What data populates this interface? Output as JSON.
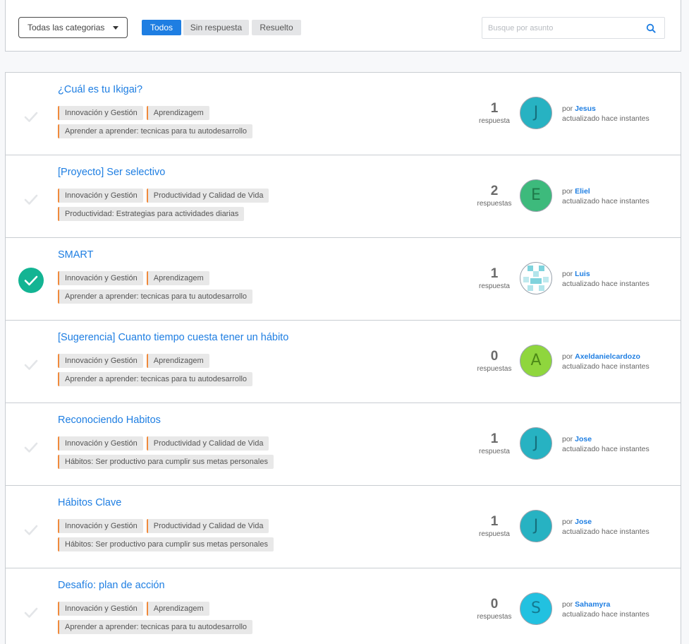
{
  "filters": {
    "category_selected": "Todas las categorias",
    "segments": [
      {
        "label": "Todos",
        "active": true
      },
      {
        "label": "Sin respuesta",
        "active": false
      },
      {
        "label": "Resuelto",
        "active": false
      }
    ],
    "search_placeholder": "Busque por asunto"
  },
  "colors": {
    "accent": "#1e7ee2",
    "tag_border": "#f08a3c",
    "solved": "#13b493"
  },
  "topics": [
    {
      "title": "¿Cuál es tu Ikigai?",
      "solved": false,
      "tags_row1": [
        "Innovación y Gestión",
        "Aprendizagem"
      ],
      "tags_row2": [
        "Aprender a aprender: tecnicas para tu autodesarrollo"
      ],
      "count": "1",
      "count_label": "respuesta",
      "avatar_letter": "J",
      "avatar_bg": "#27b2c2",
      "avatar_fg": "#166f7c",
      "by_prefix": "por",
      "user": "Jesus",
      "updated": "actualizado hace instantes"
    },
    {
      "title": "[Proyecto] Ser selectivo",
      "solved": false,
      "tags_row1": [
        "Innovación y Gestión",
        "Productividad y Calidad de Vida"
      ],
      "tags_row2": [
        "Productividad: Estrategias para actividades diarias"
      ],
      "count": "2",
      "count_label": "respuestas",
      "avatar_letter": "E",
      "avatar_bg": "#3dba7c",
      "avatar_fg": "#1f7a4a",
      "by_prefix": "por",
      "user": "Eliel",
      "updated": "actualizado hace instantes"
    },
    {
      "title": "SMART",
      "solved": true,
      "tags_row1": [
        "Innovación y Gestión",
        "Aprendizagem"
      ],
      "tags_row2": [
        "Aprender a aprender: tecnicas para tu autodesarrollo"
      ],
      "count": "1",
      "count_label": "respuesta",
      "avatar_letter": "",
      "avatar_bg": "#ffffff",
      "avatar_fg": "#7fd3dd",
      "by_prefix": "por",
      "user": "Luis",
      "updated": "actualizado hace instantes"
    },
    {
      "title": "[Sugerencia] Cuanto tiempo cuesta tener un hábito",
      "solved": false,
      "tags_row1": [
        "Innovación y Gestión",
        "Aprendizagem"
      ],
      "tags_row2": [
        "Aprender a aprender: tecnicas para tu autodesarrollo"
      ],
      "count": "0",
      "count_label": "respuestas",
      "avatar_letter": "A",
      "avatar_bg": "#8fd63d",
      "avatar_fg": "#4d8a17",
      "by_prefix": "por",
      "user": "Axeldanielcardozo",
      "updated": "actualizado hace instantes"
    },
    {
      "title": "Reconociendo Habitos",
      "solved": false,
      "tags_row1": [
        "Innovación y Gestión",
        "Productividad y Calidad de Vida"
      ],
      "tags_row2": [
        "Hábitos: Ser productivo para cumplir sus metas personales"
      ],
      "count": "1",
      "count_label": "respuesta",
      "avatar_letter": "J",
      "avatar_bg": "#27b2c2",
      "avatar_fg": "#166f7c",
      "by_prefix": "por",
      "user": "Jose",
      "updated": "actualizado hace instantes"
    },
    {
      "title": "Hábitos Clave",
      "solved": false,
      "tags_row1": [
        "Innovación y Gestión",
        "Productividad y Calidad de Vida"
      ],
      "tags_row2": [
        "Hábitos: Ser productivo para cumplir sus metas personales"
      ],
      "count": "1",
      "count_label": "respuesta",
      "avatar_letter": "J",
      "avatar_bg": "#27b2c2",
      "avatar_fg": "#166f7c",
      "by_prefix": "por",
      "user": "Jose",
      "updated": "actualizado hace instantes"
    },
    {
      "title": "Desafío: plan de acción",
      "solved": false,
      "tags_row1": [
        "Innovación y Gestión",
        "Aprendizagem"
      ],
      "tags_row2": [
        "Aprender a aprender: tecnicas para tu autodesarrollo"
      ],
      "count": "0",
      "count_label": "respuestas",
      "avatar_letter": "S",
      "avatar_bg": "#22c1e0",
      "avatar_fg": "#137a91",
      "by_prefix": "por",
      "user": "Sahamyra",
      "updated": "actualizado hace instantes"
    }
  ]
}
